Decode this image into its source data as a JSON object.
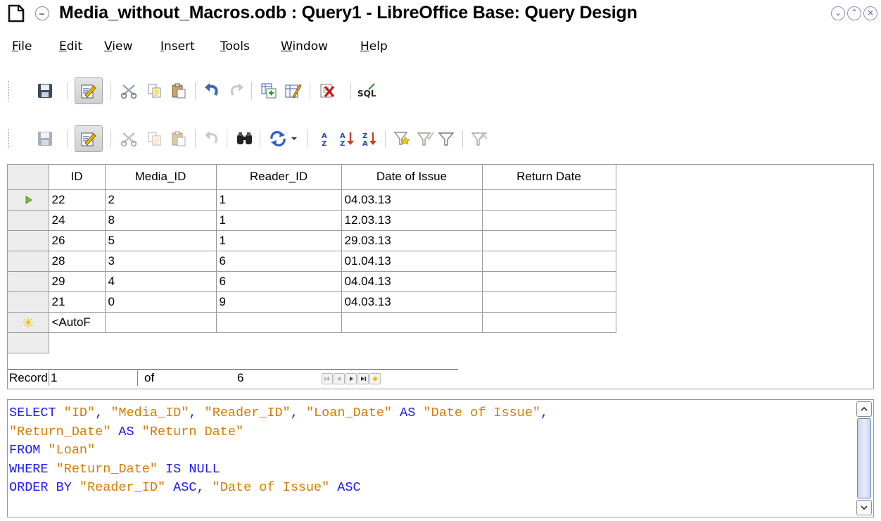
{
  "window": {
    "title": "Media_without_Macros.odb : Query1 - LibreOffice Base: Query Design",
    "icons": [
      "app-icon",
      "shade-icon",
      "minimize-icon",
      "maximize-icon",
      "close-icon"
    ]
  },
  "menu": {
    "items": [
      {
        "label": "File",
        "mnemonic": "F"
      },
      {
        "label": "Edit",
        "mnemonic": "E"
      },
      {
        "label": "View",
        "mnemonic": "V"
      },
      {
        "label": "Insert",
        "mnemonic": "I"
      },
      {
        "label": "Tools",
        "mnemonic": "T"
      },
      {
        "label": "Window",
        "mnemonic": "W"
      },
      {
        "label": "Help",
        "mnemonic": "H"
      }
    ]
  },
  "toolbar_design": {
    "icons": [
      "save-icon",
      "edit-mode-icon",
      "cut-icon",
      "copy-icon",
      "paste-icon",
      "undo-icon",
      "redo-icon",
      "add-table-icon",
      "design-view-icon",
      "delete-icon",
      "sql-icon"
    ],
    "sql_label": "SQL"
  },
  "toolbar_data": {
    "icons": [
      "save-record-icon",
      "edit-data-icon",
      "cut-icon",
      "copy-icon",
      "paste-icon",
      "undo-icon",
      "find-record-icon",
      "refresh-icon",
      "sort-icon",
      "sort-ascending-icon",
      "sort-descending-icon",
      "autofilter-icon",
      "standard-filter-icon",
      "apply-filter-icon",
      "reset-filter-icon"
    ]
  },
  "grid": {
    "columns": [
      "ID",
      "Media_ID",
      "Reader_ID",
      "Date of Issue",
      "Return Date"
    ],
    "rows": [
      [
        "22",
        "2",
        "1",
        "04.03.13",
        ""
      ],
      [
        "24",
        "8",
        "1",
        "12.03.13",
        ""
      ],
      [
        "26",
        "5",
        "1",
        "29.03.13",
        ""
      ],
      [
        "28",
        "3",
        "6",
        "01.04.13",
        ""
      ],
      [
        "29",
        "4",
        "6",
        "04.04.13",
        ""
      ],
      [
        "21",
        "0",
        "9",
        "04.03.13",
        ""
      ]
    ],
    "new_row_placeholder": "<AutoF",
    "current_row_index": 0
  },
  "navigator": {
    "record_label": "Record",
    "record_value": "1",
    "of_label": "of",
    "total": "6"
  },
  "sql": {
    "lines": [
      [
        [
          "kw",
          "SELECT "
        ],
        [
          "str",
          "\"ID\""
        ],
        [
          "kw",
          ", "
        ],
        [
          "str",
          "\"Media_ID\""
        ],
        [
          "kw",
          ", "
        ],
        [
          "str",
          "\"Reader_ID\""
        ],
        [
          "kw",
          ", "
        ],
        [
          "str",
          "\"Loan_Date\""
        ],
        [
          "kw",
          " AS "
        ],
        [
          "str",
          "\"Date of Issue\""
        ],
        [
          "kw",
          ","
        ]
      ],
      [
        [
          "str",
          "\"Return_Date\""
        ],
        [
          "kw",
          " AS "
        ],
        [
          "str",
          "\"Return Date\""
        ]
      ],
      [
        [
          "kw",
          "FROM "
        ],
        [
          "str",
          "\"Loan\""
        ]
      ],
      [
        [
          "kw",
          "WHERE "
        ],
        [
          "str",
          "\"Return_Date\""
        ],
        [
          "kw",
          " IS NULL"
        ]
      ],
      [
        [
          "kw",
          "ORDER BY "
        ],
        [
          "str",
          "\"Reader_ID\""
        ],
        [
          "kw",
          " ASC, "
        ],
        [
          "str",
          "\"Date of Issue\""
        ],
        [
          "kw",
          " ASC"
        ]
      ]
    ]
  },
  "colors": {
    "keyword": "#1a1aff",
    "string": "#d97a00",
    "accent": "#5a5fa8"
  }
}
